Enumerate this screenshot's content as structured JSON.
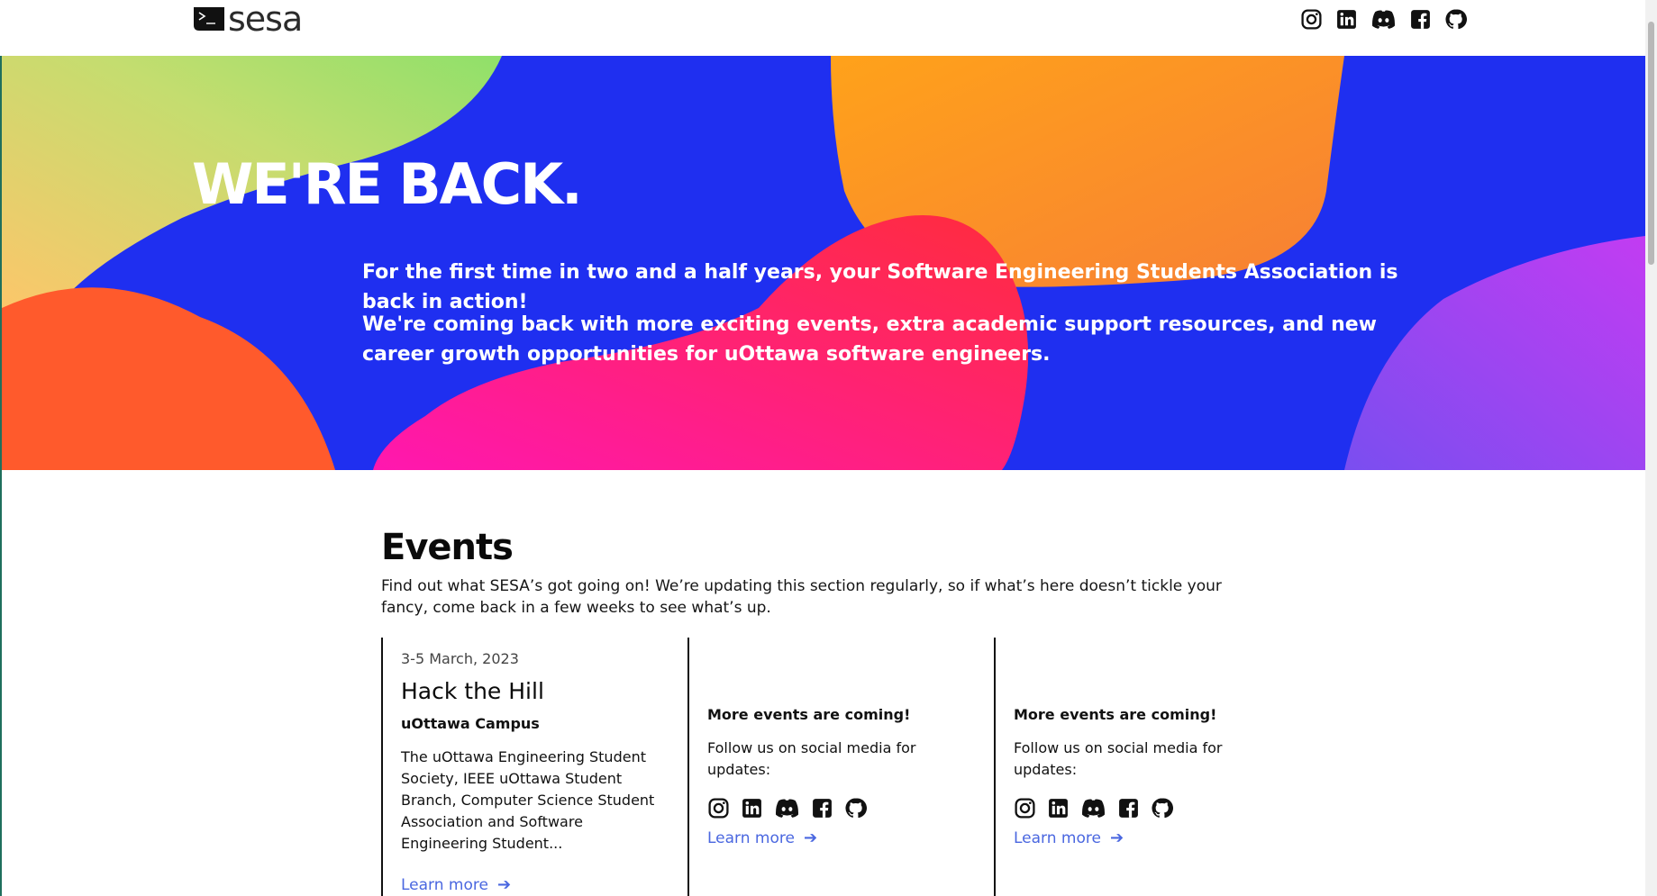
{
  "header": {
    "logo_text": "sesa",
    "social": [
      "instagram-icon",
      "linkedin-icon",
      "discord-icon",
      "facebook-icon",
      "github-icon"
    ]
  },
  "hero": {
    "title": "WE'RE BACK.",
    "paragraph1": "For the first time in two and a half years, your Software Engineering Students Association is back in action!",
    "paragraph2": "We're coming back with more exciting events, extra academic support resources, and new career growth opportunities for uOttawa software engineers.",
    "colors": {
      "background": "#1f2ff0",
      "green": "#a8e063",
      "orange": "#f7931e",
      "red": "#ff5a2c",
      "pink": "#ff1e8c",
      "purple": "#9b3df0"
    }
  },
  "events": {
    "title": "Events",
    "description": "Find out what SESA’s got going on! We’re updating this section regularly, so if what’s here doesn’t tickle your fancy, come back in a few weeks to see what’s up.",
    "cards": [
      {
        "date": "3-5 March, 2023",
        "title": "Hack the Hill",
        "location": "uOttawa Campus",
        "description": "The uOttawa Engineering Student Society, IEEE uOttawa Student Branch, Computer Science Student Association and Software Engineering Student...",
        "link": "Learn more"
      },
      {
        "heading": "More events are coming!",
        "subtext": "Follow us on social media for updates:",
        "link": "Learn more"
      },
      {
        "heading": "More events are coming!",
        "subtext": "Follow us on social media for updates:",
        "link": "Learn more"
      }
    ]
  }
}
